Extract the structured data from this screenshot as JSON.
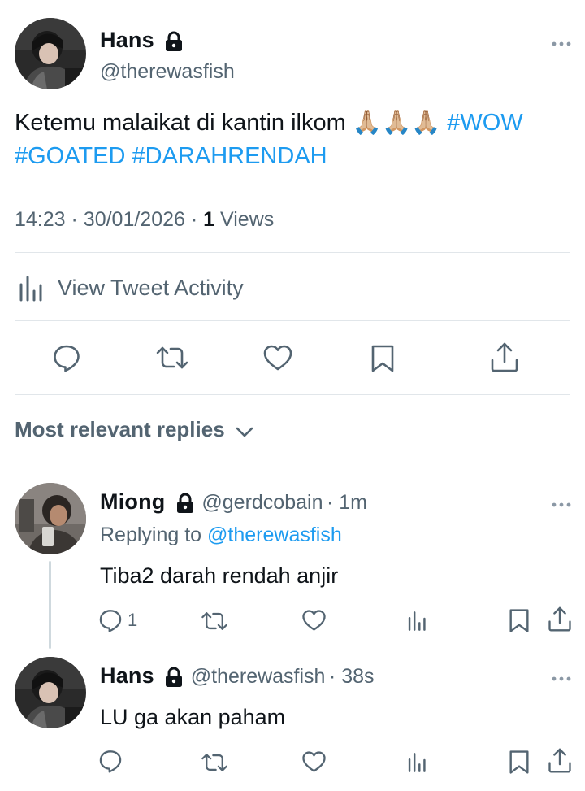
{
  "main_tweet": {
    "author_name": "Hans",
    "author_handle": "@therewasfish",
    "text": "Ketemu malaikat di kantin ilkom",
    "emoji": "🙏🏼🙏🏼🙏🏼",
    "hashtags": [
      "#WOW",
      "#GOATED",
      "#DARAHRENDAH"
    ],
    "time": "14:23",
    "date": "30/01/2026",
    "views_count": "1",
    "views_label": "Views",
    "activity_label": "View Tweet Activity"
  },
  "replies_filter": {
    "label": "Most relevant replies"
  },
  "replies": [
    {
      "author_name": "Miong",
      "author_handle": "@gerdcobain",
      "age": "1m",
      "replying_prefix": "Replying to",
      "replying_handle": "@therewasfish",
      "text": "Tiba2 darah rendah anjir",
      "reply_count": "1"
    },
    {
      "author_name": "Hans",
      "author_handle": "@therewasfish",
      "age": "38s",
      "text": "LU ga akan paham",
      "reply_count": ""
    }
  ],
  "colors": {
    "accent": "#1d9bf0",
    "muted": "#536471",
    "text": "#0f1419",
    "divider": "#e1e6ea"
  },
  "icons": [
    "more-icon",
    "lock-icon",
    "activity-icon",
    "reply-icon",
    "retweet-icon",
    "like-icon",
    "bookmark-icon",
    "share-icon",
    "views-icon",
    "chevron-down-icon"
  ]
}
